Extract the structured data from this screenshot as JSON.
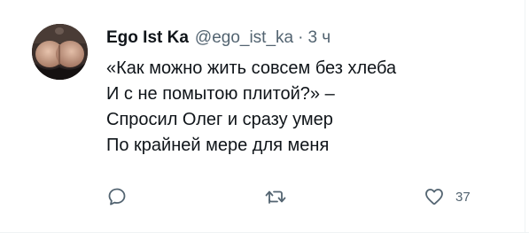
{
  "tweet": {
    "author_name": "Ego Ist Ka",
    "handle": "@ego_ist_ka",
    "separator": "·",
    "time": "3 ч",
    "text_lines": [
      "«Как можно жить совсем без хлеба",
      "И с не помытою плитой?» –",
      "Спросил Олег и сразу умер",
      "По крайней мере для меня"
    ]
  },
  "actions": {
    "reply": {
      "icon": "reply-icon",
      "count": ""
    },
    "repost": {
      "icon": "repost-icon",
      "count": ""
    },
    "like": {
      "icon": "heart-icon",
      "count": "37"
    }
  },
  "colors": {
    "text_primary": "#0f1419",
    "text_secondary": "#536471",
    "border": "#eff3f4"
  }
}
